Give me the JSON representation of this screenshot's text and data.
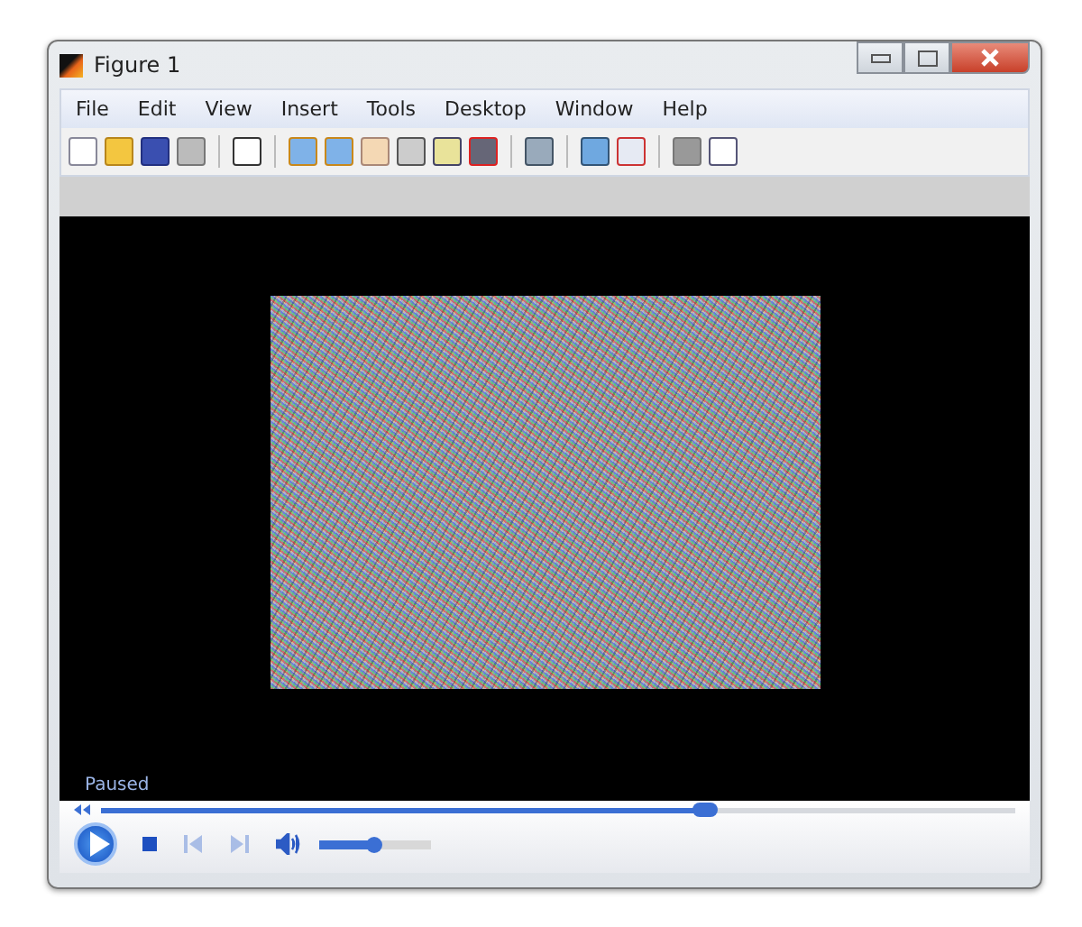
{
  "window": {
    "title": "Figure 1"
  },
  "menu": [
    "File",
    "Edit",
    "View",
    "Insert",
    "Tools",
    "Desktop",
    "Window",
    "Help"
  ],
  "player": {
    "status": "Paused",
    "seek": {
      "level": 0.66
    },
    "volume": {
      "level": 0.5
    }
  }
}
